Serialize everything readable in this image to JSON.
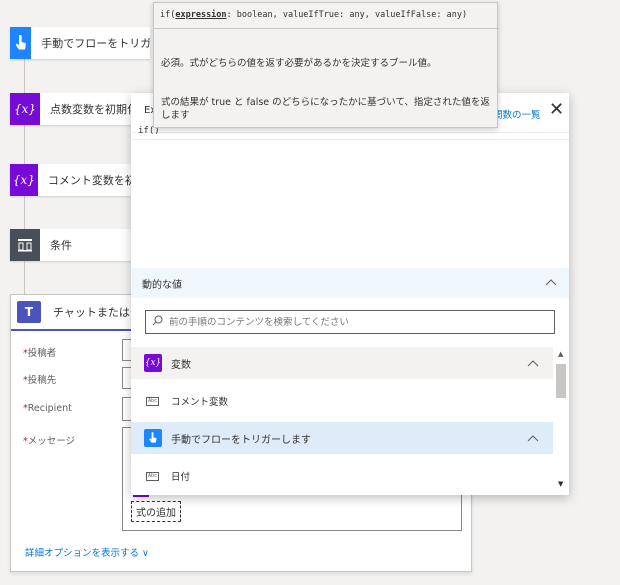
{
  "flow_steps": {
    "trigger": "手動でフローをトリガーします",
    "init_score": "点数変数を初期化",
    "init_comment": "コメント変数を初期化",
    "condition": "条件"
  },
  "chat_card": {
    "title": "チャットまたはチャネルでメッセージを投稿する",
    "icon_letter": "T",
    "fields": [
      {
        "label": "投稿者",
        "required": true
      },
      {
        "label": "投稿先",
        "required": true
      },
      {
        "label": "Recipient",
        "required": true
      },
      {
        "label": "メッセージ",
        "required": true
      }
    ],
    "required_mark": "*",
    "add_expression": "式の追加",
    "advanced_options": "詳細オプションを表示する ∨"
  },
  "expression_panel": {
    "tab_label": "Ex",
    "function_list_link": "関数の一覧",
    "close": "✕",
    "input_value": "if()",
    "dynamic_header": "動的な値",
    "search_placeholder": "前の手順のコンテンツを検索してください",
    "groups": [
      {
        "label": "変数",
        "items": [
          "コメント変数"
        ]
      },
      {
        "label": "手動でフローをトリガーします",
        "items": [
          "日付"
        ]
      }
    ]
  },
  "tooltip": {
    "sig_prefix": "if(",
    "sig_param": "expression",
    "sig_rest": ": boolean, valueIfTrue: any, valueIfFalse: any)",
    "description1": "必須。式がどちらの値を返す必要があるかを決定するブール値。",
    "description2": "式の結果が true と false のどちらになったかに基づいて、指定された値を返します"
  },
  "icons": {
    "trigger": "touch-hand-icon",
    "variable": "variable-icon",
    "condition": "condition-icon",
    "teams": "teams-icon",
    "search": "search-icon",
    "text_item": "text-type-icon"
  },
  "colors": {
    "trigger_blue": "#1f85ff",
    "variable_purple": "#770bd6",
    "condition_gray": "#484f58",
    "teams_purple": "#4b53bc",
    "link_blue": "#0078d4"
  }
}
